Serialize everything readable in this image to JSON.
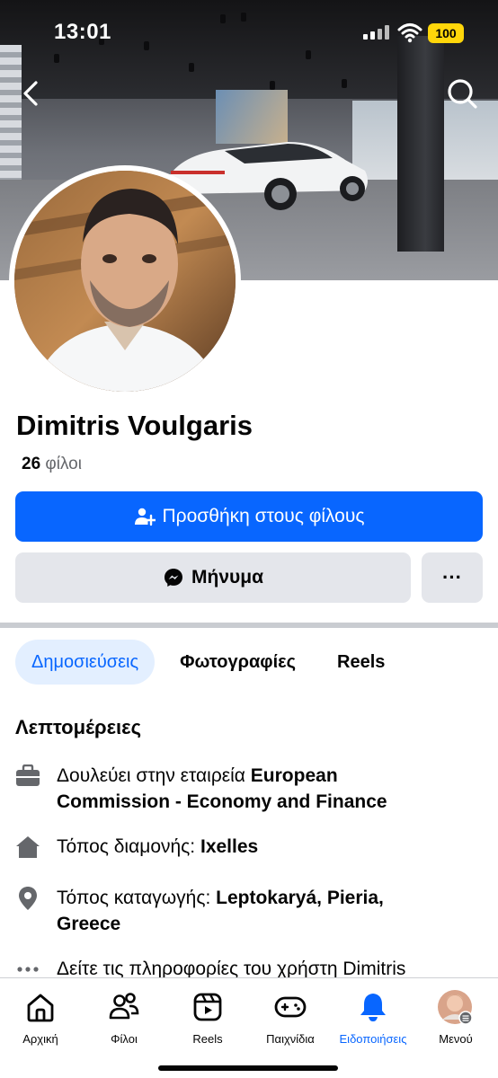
{
  "status_bar": {
    "time": "13:01",
    "battery": "100"
  },
  "profile": {
    "name": "Dimitris Voulgaris",
    "friends_count": "26",
    "friends_label": "φίλοι"
  },
  "actions": {
    "add_friend": "Προσθήκη στους φίλους",
    "message": "Μήνυμα",
    "more": "···"
  },
  "tabs": [
    {
      "label": "Δημοσιεύσεις",
      "active": true
    },
    {
      "label": "Φωτογραφίες",
      "active": false
    },
    {
      "label": "Reels",
      "active": false
    }
  ],
  "details": {
    "title": "Λεπτομέρειες",
    "work_prefix": "Δουλεύει στην εταιρεία ",
    "work_line1": "European",
    "work_line2": "Commission - Economy and Finance",
    "lives_prefix": "Τόπος διαμονής: ",
    "lives_value": "Ixelles",
    "from_prefix": "Τόπος καταγωγής: ",
    "from_line1": "Leptokaryá, Pieria,",
    "from_line2": "Greece",
    "see_info": "Δείτε τις πληροφορίες του χρήστη Dimitris"
  },
  "bottom_nav": [
    {
      "label": "Αρχική",
      "icon": "home-icon",
      "active": false
    },
    {
      "label": "Φίλοι",
      "icon": "friends-icon",
      "active": false
    },
    {
      "label": "Reels",
      "icon": "reels-icon",
      "active": false
    },
    {
      "label": "Παιχνίδια",
      "icon": "gaming-icon",
      "active": false
    },
    {
      "label": "Ειδοποιήσεις",
      "icon": "bell-icon",
      "active": true
    },
    {
      "label": "Μενού",
      "icon": "menu-avatar-icon",
      "active": false
    }
  ],
  "colors": {
    "brand_blue": "#0866ff",
    "secondary_bg": "#e4e6eb",
    "active_tab_bg": "#e3efff"
  }
}
